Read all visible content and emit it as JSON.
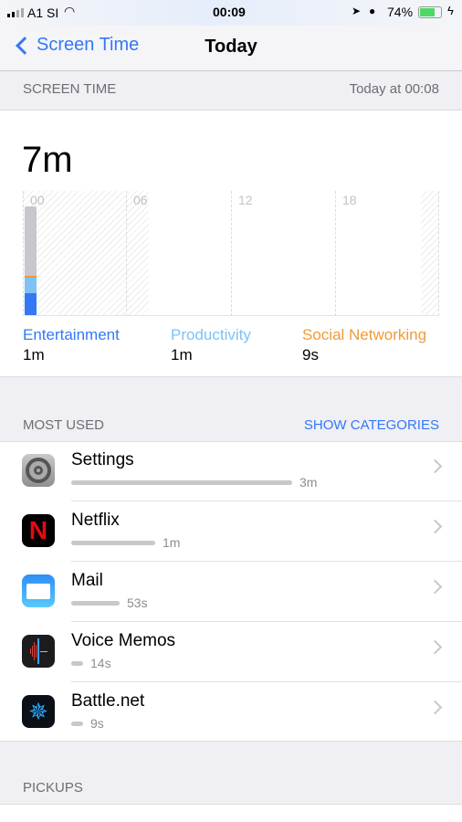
{
  "status_bar": {
    "carrier": "A1 SI",
    "time": "00:09",
    "battery": "74%",
    "battery_level": 0.74,
    "icons": [
      "signal-icon",
      "wifi-icon",
      "location-icon",
      "alarm-icon",
      "battery-icon",
      "charging-icon"
    ]
  },
  "nav": {
    "back_label": "Screen Time",
    "title": "Today"
  },
  "screen_time": {
    "header": "SCREEN TIME",
    "updated": "Today at 00:08",
    "total": "7m",
    "chart": {
      "type": "bar",
      "stacked": true,
      "x_ticks": [
        "00",
        "06",
        "12",
        "18"
      ],
      "unit": "minutes",
      "bars": [
        {
          "hour": 0,
          "segments": [
            {
              "category": "Entertainment",
              "value": 1.4,
              "color": "#3478f6"
            },
            {
              "category": "Productivity",
              "value": 1.0,
              "color": "#7fc2f5"
            },
            {
              "category": "Social Networking",
              "value": 0.15,
              "color": "#f19a37"
            },
            {
              "category": "Other",
              "value": 4.45,
              "color": "#c7c7cc"
            }
          ]
        }
      ],
      "ymax": 8
    },
    "categories": [
      {
        "name": "Entertainment",
        "time": "1m",
        "color": "#3478f6"
      },
      {
        "name": "Productivity",
        "time": "1m",
        "color": "#7fc2f5"
      },
      {
        "name": "Social Networking",
        "time": "9s",
        "color": "#f19a37"
      }
    ]
  },
  "most_used": {
    "header": "MOST USED",
    "action": "SHOW CATEGORIES",
    "apps": [
      {
        "name": "Settings",
        "time": "3m",
        "fraction": 1.0,
        "icon": "settings-icon"
      },
      {
        "name": "Netflix",
        "time": "1m",
        "fraction": 0.38,
        "icon": "netflix-icon"
      },
      {
        "name": "Mail",
        "time": "53s",
        "fraction": 0.22,
        "icon": "mail-icon"
      },
      {
        "name": "Voice Memos",
        "time": "14s",
        "fraction": 0.055,
        "icon": "voice-memos-icon"
      },
      {
        "name": "Battle.net",
        "time": "9s",
        "fraction": 0.05,
        "icon": "battlenet-icon"
      }
    ]
  },
  "pickups": {
    "header": "PICKUPS"
  },
  "colors": {
    "accent": "#3478f6"
  }
}
